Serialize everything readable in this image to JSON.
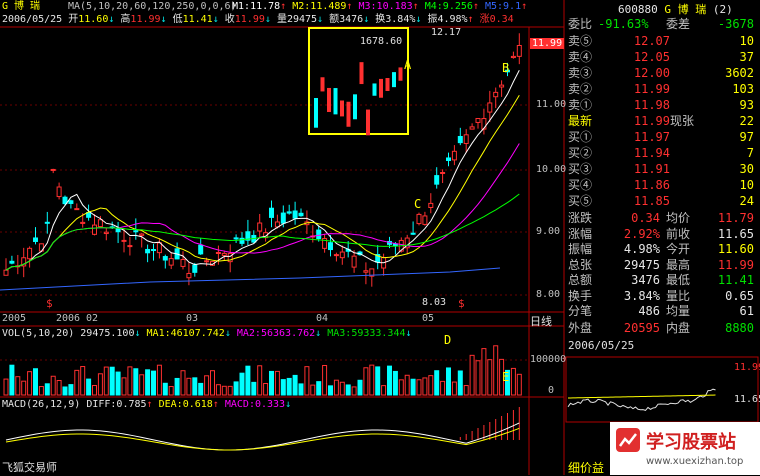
{
  "stock": {
    "code": "600880",
    "name": "G 博  瑞",
    "name_short": "G 博  瑞",
    "count": "(2)"
  },
  "header": {
    "date": "2006/05/25",
    "open_label": "开",
    "open": "11.60",
    "high_label": "高",
    "high": "11.99",
    "low_label": "低",
    "low": "11.41",
    "close_label": "收",
    "close": "11.99",
    "volume_label": "量",
    "volume": "29475",
    "amount_label": "额",
    "amount": "3476",
    "turnover_label": "换",
    "turnover": "3.84%",
    "amplitude_label": "振",
    "amplitude": "4.98%",
    "change_label": "涨",
    "change": "0.34",
    "ma_title": "MA(5,10,20,60,120,250,0,0,6)",
    "ma": [
      {
        "label": "M1:",
        "value": "11.78",
        "color": "#ffffff"
      },
      {
        "label": "M2:",
        "value": "11.489",
        "color": "#ffff00"
      },
      {
        "label": "M3:",
        "value": "10.183",
        "color": "#ff00ff"
      },
      {
        "label": "M4:",
        "value": "9.256",
        "color": "#00ff00"
      },
      {
        "label": "M5:",
        "value": "9.1",
        "color": "#3366ff"
      }
    ]
  },
  "price_axis": [
    "11.00",
    "10.00",
    "9.00",
    "8.00"
  ],
  "current_price_tag": "11.99",
  "annotations": {
    "high_mark": "12.17",
    "low_mark": "8.03",
    "inset_value": "1678.60",
    "a": "A",
    "b": "B",
    "c": "C",
    "d": "D",
    "e": "E",
    "s1": "$",
    "s2": "$"
  },
  "x_axis": {
    "labels": [
      "2005",
      "2006",
      "02",
      "03",
      "04",
      "05"
    ],
    "period": "日线"
  },
  "vol_panel": {
    "title": "VOL(5,10,20)",
    "vol": "29475.100",
    "ma1_label": "MA1:",
    "ma1": "46107.742",
    "ma2_label": "MA2:",
    "ma2": "56363.762",
    "ma3_label": "MA3:",
    "ma3": "59333.344",
    "axis_top": "100000",
    "axis_bottom": "0"
  },
  "macd_panel": {
    "title": "MACD(26,12,9)",
    "diff_label": "DIFF:",
    "diff": "0.785",
    "dea_label": "DEA:",
    "dea": "0.618",
    "macd_label": "MACD:",
    "macd": "0.333"
  },
  "footer": {
    "software": "飞狐交易师",
    "tick_label": "细价益"
  },
  "quote": {
    "ratio_label": "委比",
    "ratio": "-91.63%",
    "diff_label": "委差",
    "diff": "-3678",
    "sells": [
      {
        "label": "卖⑤",
        "price": "12.07",
        "vol": "10"
      },
      {
        "label": "卖④",
        "price": "12.05",
        "vol": "37"
      },
      {
        "label": "卖③",
        "price": "12.00",
        "vol": "3602"
      },
      {
        "label": "卖②",
        "price": "11.99",
        "vol": "103"
      },
      {
        "label": "卖①",
        "price": "11.98",
        "vol": "93"
      }
    ],
    "latest_label": "最新",
    "latest": "11.99",
    "hand_label": "现张",
    "hand": "22",
    "buys": [
      {
        "label": "买①",
        "price": "11.97",
        "vol": "97"
      },
      {
        "label": "买②",
        "price": "11.94",
        "vol": "7"
      },
      {
        "label": "买③",
        "price": "11.91",
        "vol": "30"
      },
      {
        "label": "买④",
        "price": "11.86",
        "vol": "10"
      },
      {
        "label": "买⑤",
        "price": "11.85",
        "vol": "24"
      }
    ],
    "stats": [
      {
        "l1": "涨跌",
        "v1": "0.34",
        "c1": "red",
        "l2": "均价",
        "v2": "11.79",
        "c2": "red"
      },
      {
        "l1": "涨幅",
        "v1": "2.92%",
        "c1": "red",
        "l2": "前收",
        "v2": "11.65",
        "c2": "wht"
      },
      {
        "l1": "振幅",
        "v1": "4.98%",
        "c1": "wht",
        "l2": "今开",
        "v2": "11.60",
        "c2": "yel"
      },
      {
        "l1": "总张",
        "v1": "29475",
        "c1": "wht",
        "l2": "最高",
        "v2": "11.99",
        "c2": "red"
      },
      {
        "l1": "总额",
        "v1": "3476",
        "c1": "wht",
        "l2": "最低",
        "v2": "11.41",
        "c2": "grn"
      },
      {
        "l1": "换手",
        "v1": "3.84%",
        "c1": "wht",
        "l2": "量比",
        "v2": "0.65",
        "c2": "wht"
      },
      {
        "l1": "分笔",
        "v1": "486",
        "c1": "wht",
        "l2": "均量",
        "v2": "61",
        "c2": "wht"
      }
    ],
    "outer_label": "外盘",
    "outer": "20595",
    "inner_label": "内盘",
    "inner": "8880"
  },
  "intraday": {
    "date": "2006/05/25",
    "top": "11.99",
    "bottom": "11.65"
  },
  "watermark": {
    "text": "学习股票站",
    "url": "www.xuexizhan.top"
  },
  "colors": {
    "up": "#ff3030",
    "down": "#00ffff",
    "frame": "#b00000",
    "ma5": "#ffffff",
    "ma10": "#ffff00",
    "ma20": "#ff00ff",
    "ma60": "#00ff00",
    "ma120": "#3366ff"
  }
}
